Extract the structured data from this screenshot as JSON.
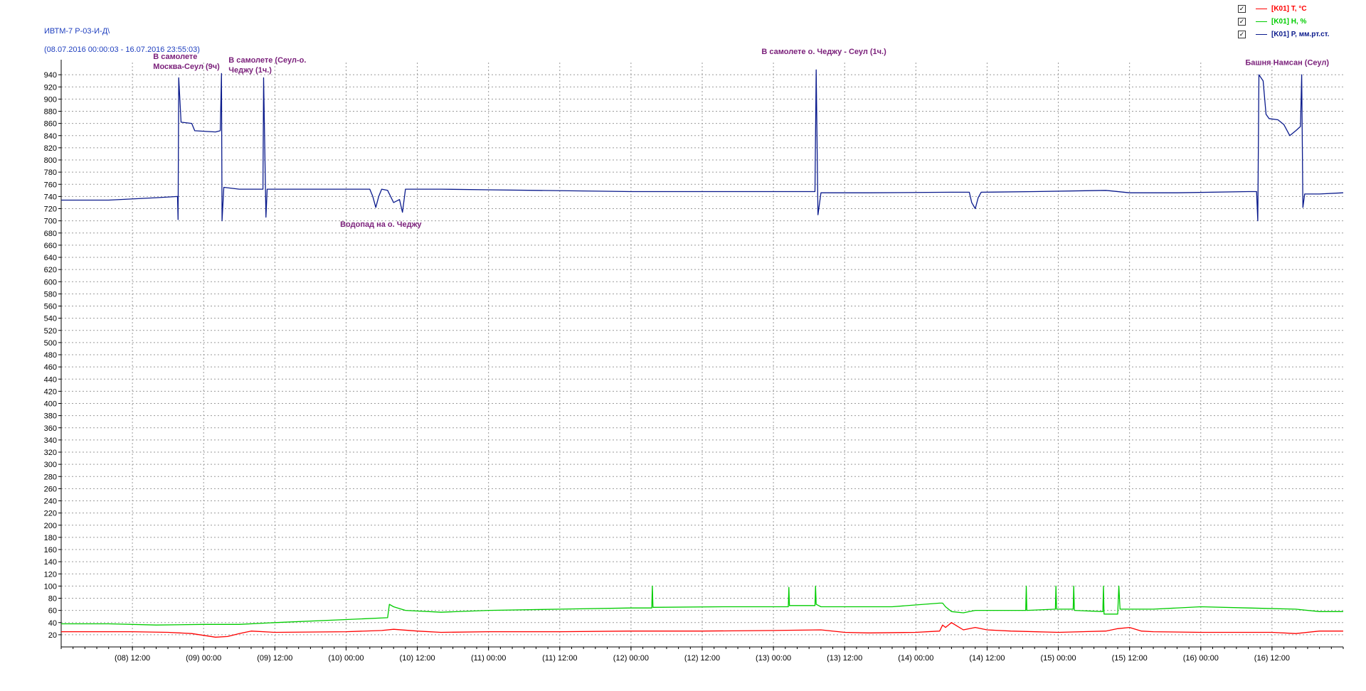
{
  "header": {
    "device": "ИВТМ-7 Р-03-И-Д\\",
    "period": "(08.07.2016 00:00:03 - 16.07.2016 23:55:03)"
  },
  "legend": [
    {
      "checked": "✓",
      "label": "[K01] T, °C",
      "color": "#ff0000"
    },
    {
      "checked": "✓",
      "label": "[K01] H, %",
      "color": "#00cc00"
    },
    {
      "checked": "✓",
      "label": "[K01] P, мм.рт.ст.",
      "color": "#0a1a8c"
    }
  ],
  "chart_data": {
    "type": "line",
    "x_unit": "hours since 08.07.2016 00:00",
    "xlim": [
      0,
      216
    ],
    "ylim": [
      0,
      960
    ],
    "ytick_step": 20,
    "grid": true,
    "legend_position": "top-right",
    "xticks": [
      {
        "x": 12,
        "label": "(08) 12:00"
      },
      {
        "x": 24,
        "label": "(09) 00:00"
      },
      {
        "x": 36,
        "label": "(09) 12:00"
      },
      {
        "x": 48,
        "label": "(10) 00:00"
      },
      {
        "x": 60,
        "label": "(10) 12:00"
      },
      {
        "x": 72,
        "label": "(11) 00:00"
      },
      {
        "x": 84,
        "label": "(11) 12:00"
      },
      {
        "x": 96,
        "label": "(12) 00:00"
      },
      {
        "x": 108,
        "label": "(12) 12:00"
      },
      {
        "x": 120,
        "label": "(13) 00:00"
      },
      {
        "x": 132,
        "label": "(13) 12:00"
      },
      {
        "x": 144,
        "label": "(14) 00:00"
      },
      {
        "x": 156,
        "label": "(14) 12:00"
      },
      {
        "x": 168,
        "label": "(15) 00:00"
      },
      {
        "x": 180,
        "label": "(15) 12:00"
      },
      {
        "x": 192,
        "label": "(16) 00:00"
      },
      {
        "x": 204,
        "label": "(16) 12:00"
      }
    ],
    "series": [
      {
        "name": "[K01] P, мм.рт.ст.",
        "color": "#0a1a8c",
        "points": [
          [
            0,
            734
          ],
          [
            8,
            734
          ],
          [
            16,
            738
          ],
          [
            19.6,
            740
          ],
          [
            19.7,
            702
          ],
          [
            19.8,
            935
          ],
          [
            20.2,
            862
          ],
          [
            22,
            860
          ],
          [
            22.5,
            848
          ],
          [
            26,
            846
          ],
          [
            26.8,
            848
          ],
          [
            27,
            942
          ],
          [
            27.1,
            700
          ],
          [
            27.4,
            755
          ],
          [
            30,
            752
          ],
          [
            34,
            752
          ],
          [
            34.1,
            935
          ],
          [
            34.5,
            706
          ],
          [
            34.7,
            752
          ],
          [
            40,
            752
          ],
          [
            52,
            752
          ],
          [
            52.5,
            740
          ],
          [
            53,
            722
          ],
          [
            53.5,
            740
          ],
          [
            54,
            752
          ],
          [
            55,
            750
          ],
          [
            56,
            730
          ],
          [
            57,
            735
          ],
          [
            57.5,
            714
          ],
          [
            58,
            752
          ],
          [
            64,
            752
          ],
          [
            72,
            751
          ],
          [
            80,
            750
          ],
          [
            96,
            748
          ],
          [
            112,
            748
          ],
          [
            127,
            748
          ],
          [
            127.2,
            948
          ],
          [
            127.5,
            710
          ],
          [
            128,
            746
          ],
          [
            136,
            746
          ],
          [
            150,
            747
          ],
          [
            153,
            747
          ],
          [
            153.4,
            730
          ],
          [
            154,
            720
          ],
          [
            154.5,
            738
          ],
          [
            155,
            747
          ],
          [
            164,
            748
          ],
          [
            176,
            750
          ],
          [
            180,
            746
          ],
          [
            188,
            746
          ],
          [
            200,
            748
          ],
          [
            201.4,
            748
          ],
          [
            201.6,
            700
          ],
          [
            201.8,
            940
          ],
          [
            202.5,
            930
          ],
          [
            203,
            875
          ],
          [
            203.5,
            868
          ],
          [
            205,
            866
          ],
          [
            206,
            858
          ],
          [
            207,
            840
          ],
          [
            208,
            848
          ],
          [
            208.8,
            855
          ],
          [
            209,
            940
          ],
          [
            209.2,
            722
          ],
          [
            209.5,
            744
          ],
          [
            212,
            744
          ],
          [
            216,
            746
          ]
        ]
      },
      {
        "name": "[K01] H, %",
        "color": "#00cc00",
        "points": [
          [
            0,
            38
          ],
          [
            8,
            38
          ],
          [
            16,
            36
          ],
          [
            24,
            37
          ],
          [
            30,
            37
          ],
          [
            36,
            40
          ],
          [
            48,
            45
          ],
          [
            55,
            48
          ],
          [
            55.3,
            70
          ],
          [
            56,
            66
          ],
          [
            58,
            60
          ],
          [
            64,
            57
          ],
          [
            72,
            60
          ],
          [
            84,
            62
          ],
          [
            96,
            64
          ],
          [
            99.5,
            64
          ],
          [
            99.6,
            100
          ],
          [
            99.7,
            65
          ],
          [
            112,
            66
          ],
          [
            120,
            66
          ],
          [
            122.5,
            66
          ],
          [
            122.6,
            98
          ],
          [
            122.7,
            68
          ],
          [
            127,
            68
          ],
          [
            127.1,
            100
          ],
          [
            127.2,
            70
          ],
          [
            128,
            66
          ],
          [
            140,
            66
          ],
          [
            148,
            72
          ],
          [
            148.5,
            72
          ],
          [
            149,
            66
          ],
          [
            150,
            58
          ],
          [
            152,
            56
          ],
          [
            154,
            60
          ],
          [
            160,
            60
          ],
          [
            162.5,
            60
          ],
          [
            162.6,
            100
          ],
          [
            162.7,
            60
          ],
          [
            167.5,
            62
          ],
          [
            167.6,
            100
          ],
          [
            167.7,
            62
          ],
          [
            170.5,
            62
          ],
          [
            170.6,
            100
          ],
          [
            170.7,
            60
          ],
          [
            175.5,
            58
          ],
          [
            175.6,
            100
          ],
          [
            175.7,
            54
          ],
          [
            178,
            54
          ],
          [
            178.2,
            100
          ],
          [
            178.4,
            62
          ],
          [
            184,
            62
          ],
          [
            192,
            66
          ],
          [
            200,
            64
          ],
          [
            208,
            62
          ],
          [
            212,
            58
          ],
          [
            216,
            58
          ]
        ]
      },
      {
        "name": "[K01] T, °C",
        "color": "#ff0000",
        "points": [
          [
            0,
            25
          ],
          [
            12,
            25
          ],
          [
            18,
            24
          ],
          [
            22,
            22
          ],
          [
            26,
            16
          ],
          [
            28,
            17
          ],
          [
            30,
            22
          ],
          [
            32,
            26
          ],
          [
            36,
            24
          ],
          [
            48,
            25
          ],
          [
            54,
            27
          ],
          [
            56,
            29
          ],
          [
            60,
            26
          ],
          [
            64,
            24
          ],
          [
            72,
            25
          ],
          [
            84,
            25
          ],
          [
            96,
            26
          ],
          [
            108,
            26
          ],
          [
            120,
            27
          ],
          [
            128,
            28
          ],
          [
            132,
            24
          ],
          [
            136,
            23
          ],
          [
            144,
            24
          ],
          [
            148,
            26
          ],
          [
            148.5,
            36
          ],
          [
            149,
            32
          ],
          [
            150,
            40
          ],
          [
            151,
            34
          ],
          [
            152,
            28
          ],
          [
            154,
            32
          ],
          [
            156,
            28
          ],
          [
            160,
            26
          ],
          [
            168,
            24
          ],
          [
            176,
            26
          ],
          [
            178,
            30
          ],
          [
            180,
            32
          ],
          [
            182,
            26
          ],
          [
            184,
            25
          ],
          [
            192,
            24
          ],
          [
            204,
            24
          ],
          [
            208,
            22
          ],
          [
            212,
            26
          ],
          [
            216,
            26
          ]
        ]
      }
    ],
    "annotations": [
      {
        "lines": [
          "В самолете",
          "Москва-Сеул (9ч)"
        ],
        "x": 15.5,
        "y": 966
      },
      {
        "lines": [
          "В самолете (Сеул-о.",
          "Чеджу (1ч.)"
        ],
        "x": 28.2,
        "y": 960
      },
      {
        "lines": [
          "Водопад на о. Чеджу"
        ],
        "x": 47,
        "y": 690
      },
      {
        "lines": [
          "В самолете о. Чеджу - Сеул (1ч.)"
        ],
        "x": 118,
        "y": 974
      },
      {
        "lines": [
          "Башня Намсан (Сеул)"
        ],
        "x": 199.5,
        "y": 956
      }
    ]
  }
}
